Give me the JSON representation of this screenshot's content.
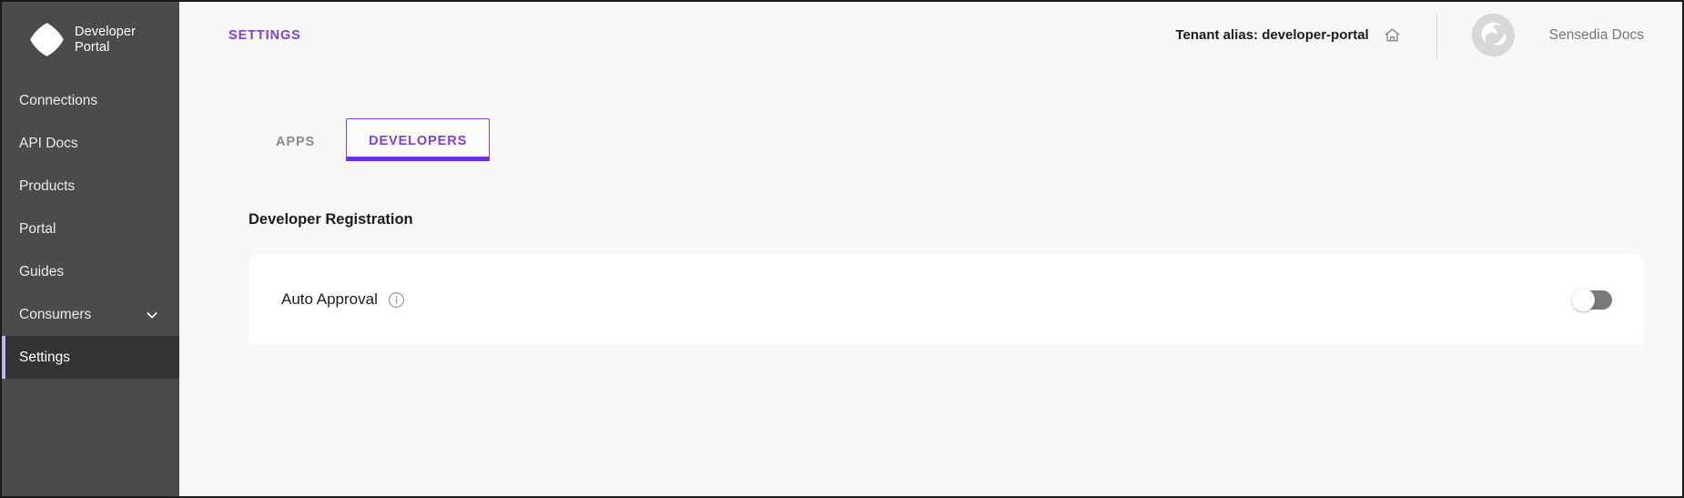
{
  "sidebar": {
    "brand": {
      "name": "Developer\nPortal",
      "logo_icon": "developer-portal-logo"
    },
    "items": [
      {
        "label": "Connections",
        "active": false,
        "chevron": false
      },
      {
        "label": "API Docs",
        "active": false,
        "chevron": false
      },
      {
        "label": "Products",
        "active": false,
        "chevron": false
      },
      {
        "label": "Portal",
        "active": false,
        "chevron": false
      },
      {
        "label": "Guides",
        "active": false,
        "chevron": false
      },
      {
        "label": "Consumers",
        "active": false,
        "chevron": true
      },
      {
        "label": "Settings",
        "active": true,
        "chevron": false
      }
    ]
  },
  "topbar": {
    "kicker": "SETTINGS",
    "tenant_label": "Tenant alias: developer-portal",
    "home_icon": "home-icon",
    "account_name": "Sensedia Docs",
    "avatar_icon": "avatar"
  },
  "content": {
    "tabs": [
      {
        "label": "APPS",
        "active": false
      },
      {
        "label": "DEVELOPERS",
        "active": true
      }
    ],
    "section_title": "Developer Registration",
    "card": {
      "label": "Auto Approval",
      "info_icon": "info-icon",
      "toggle_state": "off"
    }
  },
  "colors": {
    "accent": "#7b3fe4",
    "tab_underline": "#6f2ce0",
    "sidebar_bg": "#4b4b4b",
    "sidebar_active_bg": "#333333",
    "sidebar_active_accent": "#c5b3ef",
    "page_bg": "#f8f8f8",
    "card_bg": "#ffffff",
    "toggle_off_track": "#7a7a7a"
  }
}
